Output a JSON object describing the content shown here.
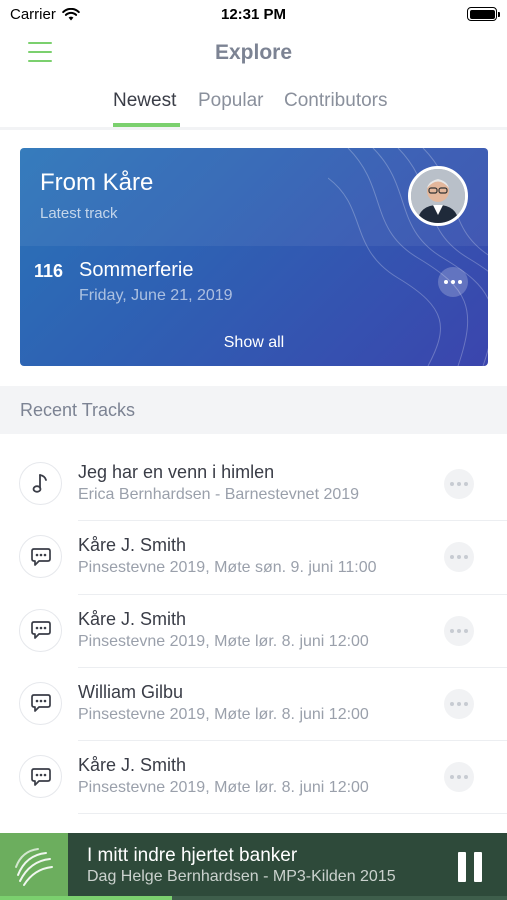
{
  "status_bar": {
    "carrier": "Carrier",
    "time": "12:31 PM"
  },
  "nav": {
    "title": "Explore",
    "menu_icon": "hamburger-menu-icon"
  },
  "tabs": [
    {
      "label": "Newest",
      "active": true
    },
    {
      "label": "Popular",
      "active": false
    },
    {
      "label": "Contributors",
      "active": false
    }
  ],
  "featured": {
    "title": "From Kåre",
    "subtitle": "Latest track",
    "track_number": "116",
    "track_title": "Sommerferie",
    "track_date": "Friday, June 21, 2019",
    "show_all_label": "Show all"
  },
  "recent": {
    "header": "Recent Tracks",
    "tracks": [
      {
        "icon": "music-note-icon",
        "title": "Jeg har en venn i himlen",
        "subtitle": "Erica Bernhardsen - Barnestevnet 2019"
      },
      {
        "icon": "speech-bubble-icon",
        "title": "Kåre J. Smith",
        "subtitle": "Pinsestevne 2019, Møte søn. 9. juni 11:00"
      },
      {
        "icon": "speech-bubble-icon",
        "title": "Kåre J. Smith",
        "subtitle": "Pinsestevne 2019, Møte lør. 8. juni 12:00"
      },
      {
        "icon": "speech-bubble-icon",
        "title": "William Gilbu",
        "subtitle": "Pinsestevne 2019, Møte lør. 8. juni 12:00"
      },
      {
        "icon": "speech-bubble-icon",
        "title": "Kåre J. Smith",
        "subtitle": "Pinsestevne 2019, Møte lør. 8. juni 12:00"
      }
    ]
  },
  "player": {
    "title": "I mitt indre hjertet banker",
    "subtitle": "Dag Helge Bernhardsen - MP3-Kilden 2015",
    "progress": 0.34,
    "state": "playing"
  },
  "colors": {
    "accent": "#7bd06e",
    "player_bg": "#2e4a3a",
    "card_gradient_start": "#2a74b8",
    "card_gradient_end": "#3b45ad"
  }
}
